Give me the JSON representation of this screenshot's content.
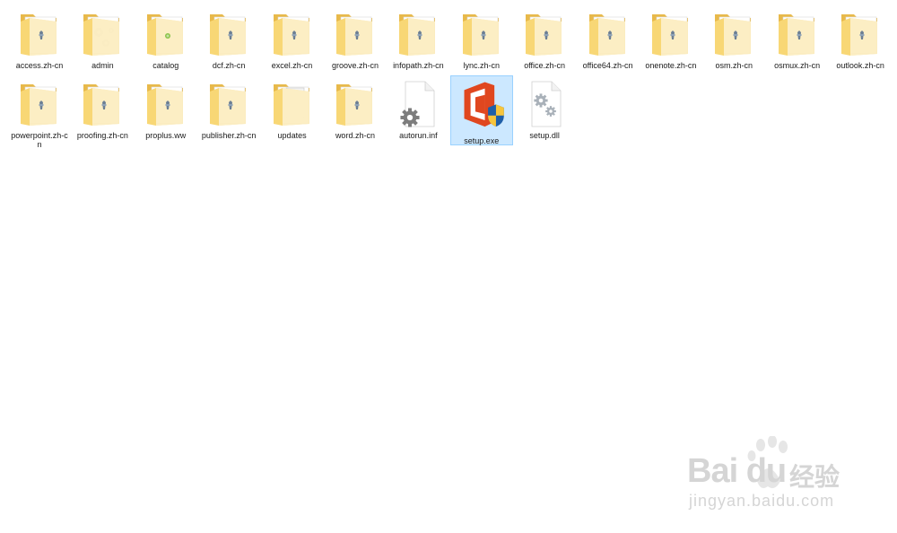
{
  "items": [
    {
      "name": "access.zh-cn",
      "kind": "folder"
    },
    {
      "name": "admin",
      "kind": "folder-gears"
    },
    {
      "name": "catalog",
      "kind": "folder-dot"
    },
    {
      "name": "dcf.zh-cn",
      "kind": "folder"
    },
    {
      "name": "excel.zh-cn",
      "kind": "folder"
    },
    {
      "name": "groove.zh-cn",
      "kind": "folder"
    },
    {
      "name": "infopath.zh-cn",
      "kind": "folder"
    },
    {
      "name": "lync.zh-cn",
      "kind": "folder"
    },
    {
      "name": "office.zh-cn",
      "kind": "folder"
    },
    {
      "name": "office64.zh-cn",
      "kind": "folder"
    },
    {
      "name": "onenote.zh-cn",
      "kind": "folder"
    },
    {
      "name": "osm.zh-cn",
      "kind": "folder"
    },
    {
      "name": "osmux.zh-cn",
      "kind": "folder"
    },
    {
      "name": "outlook.zh-cn",
      "kind": "folder"
    },
    {
      "name": "powerpoint.zh-cn",
      "kind": "folder"
    },
    {
      "name": "proofing.zh-cn",
      "kind": "folder"
    },
    {
      "name": "proplus.ww",
      "kind": "folder"
    },
    {
      "name": "publisher.zh-cn",
      "kind": "folder"
    },
    {
      "name": "updates",
      "kind": "folder-doc"
    },
    {
      "name": "word.zh-cn",
      "kind": "folder"
    },
    {
      "name": "autorun.inf",
      "kind": "inf"
    },
    {
      "name": "setup.exe",
      "kind": "exe",
      "selected": true
    },
    {
      "name": "setup.dll",
      "kind": "dll"
    }
  ],
  "watermark": {
    "brand": "Bai du",
    "cn": "经验",
    "url": "jingyan.baidu.com"
  },
  "colors": {
    "folder_back": "#e8b94a",
    "folder_front": "#f8d775",
    "selection_bg": "#cce8ff",
    "selection_border": "#99d1ff",
    "office_red": "#e0471f"
  }
}
